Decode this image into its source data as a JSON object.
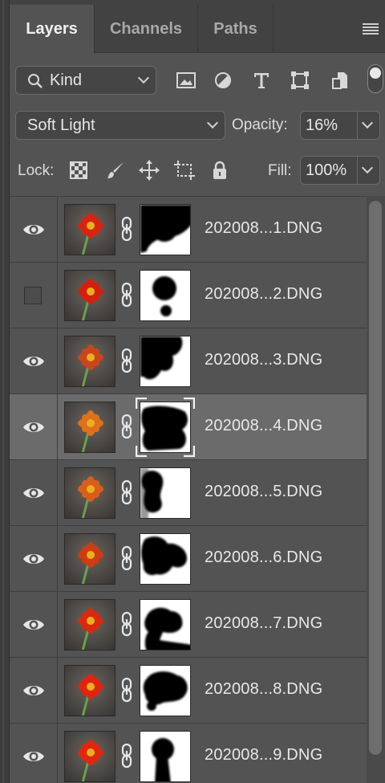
{
  "tabs": [
    {
      "label": "Layers",
      "active": true
    },
    {
      "label": "Channels",
      "active": false
    },
    {
      "label": "Paths",
      "active": false
    }
  ],
  "filter": {
    "kind_label": "Kind",
    "icons": [
      "image-filter-icon",
      "adjustment-filter-icon",
      "type-filter-icon",
      "shape-filter-icon",
      "smart-object-filter-icon"
    ]
  },
  "blend": {
    "mode": "Soft Light",
    "opacity_label": "Opacity:",
    "opacity_value": "16%"
  },
  "lock": {
    "label": "Lock:",
    "icons": [
      "lock-transparent-icon",
      "lock-image-icon",
      "lock-position-icon",
      "artboard-icon",
      "lock-all-icon"
    ],
    "fill_label": "Fill:",
    "fill_value": "100%"
  },
  "layers": [
    {
      "name": "202008...1.DNG",
      "visible": true,
      "selected": false
    },
    {
      "name": "202008...2.DNG",
      "visible": false,
      "selected": false
    },
    {
      "name": "202008...3.DNG",
      "visible": true,
      "selected": false
    },
    {
      "name": "202008...4.DNG",
      "visible": true,
      "selected": true
    },
    {
      "name": "202008...5.DNG",
      "visible": true,
      "selected": false
    },
    {
      "name": "202008...6.DNG",
      "visible": true,
      "selected": false
    },
    {
      "name": "202008...7.DNG",
      "visible": true,
      "selected": false
    },
    {
      "name": "202008...8.DNG",
      "visible": true,
      "selected": false
    },
    {
      "name": "202008...9.DNG",
      "visible": true,
      "selected": false
    }
  ],
  "colors": {
    "panel_bg": "#535353",
    "selected_row": "#6b6b6b",
    "flower_red": "#d8230f",
    "flower_orange": "#e0701a"
  }
}
